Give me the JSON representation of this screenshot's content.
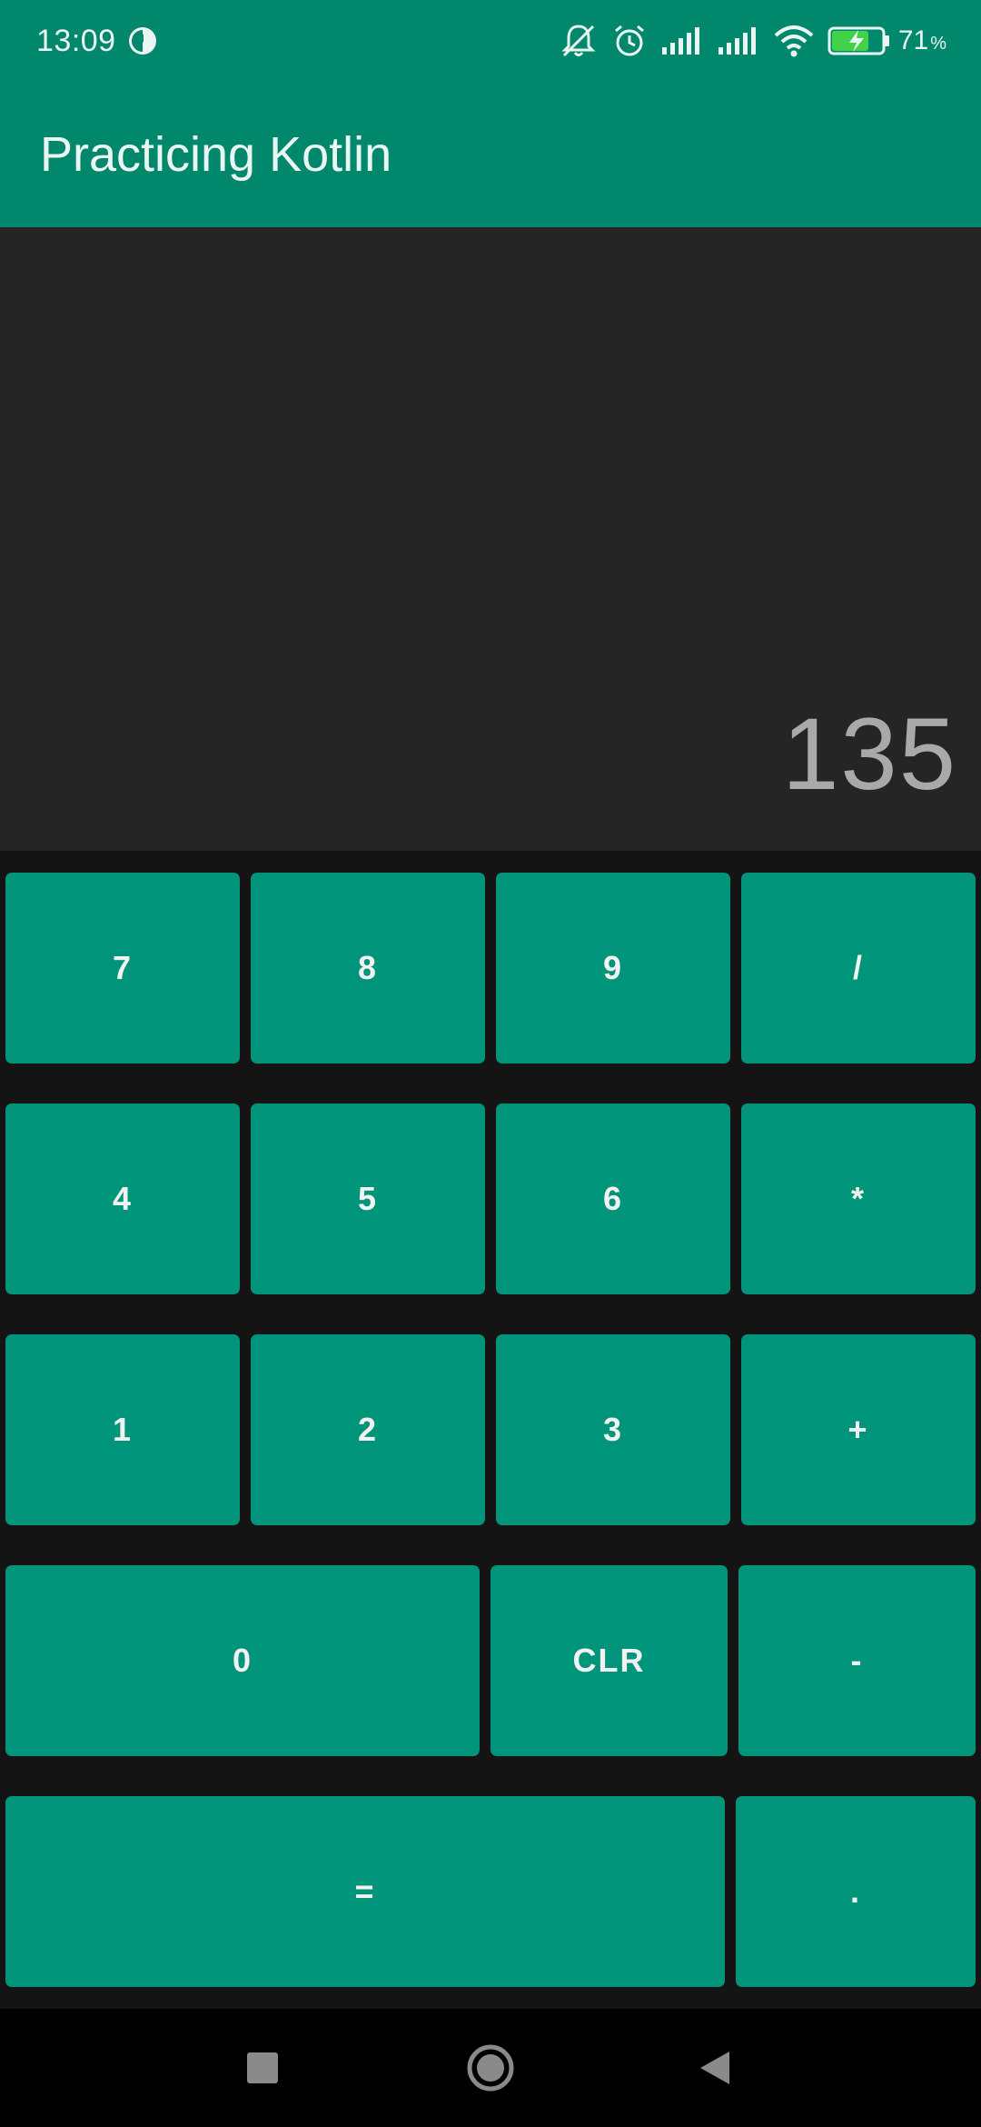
{
  "status_bar": {
    "time": "13:09",
    "battery_percent": "71",
    "battery_unit": "%",
    "icons": [
      "app-notification-icon",
      "silent-bell-icon",
      "alarm-icon",
      "signal-icon",
      "signal-icon",
      "wifi-icon",
      "battery-charging-icon"
    ]
  },
  "app_bar": {
    "title": "Practicing Kotlin"
  },
  "display": {
    "value": "135"
  },
  "keys": {
    "k7": "7",
    "k8": "8",
    "k9": "9",
    "div": "/",
    "k4": "4",
    "k5": "5",
    "k6": "6",
    "mul": "*",
    "k1": "1",
    "k2": "2",
    "k3": "3",
    "add": "+",
    "k0": "0",
    "clr": "CLR",
    "sub": "-",
    "eq": "=",
    "dot": "."
  },
  "nav_bar": {
    "buttons": [
      "recents-square-icon",
      "home-circle-icon",
      "back-triangle-icon"
    ]
  },
  "colors": {
    "primary": "#00876c",
    "key": "#00957a",
    "display_bg": "#252525",
    "keypad_bg": "#141414",
    "display_text": "#a9a9a9"
  }
}
